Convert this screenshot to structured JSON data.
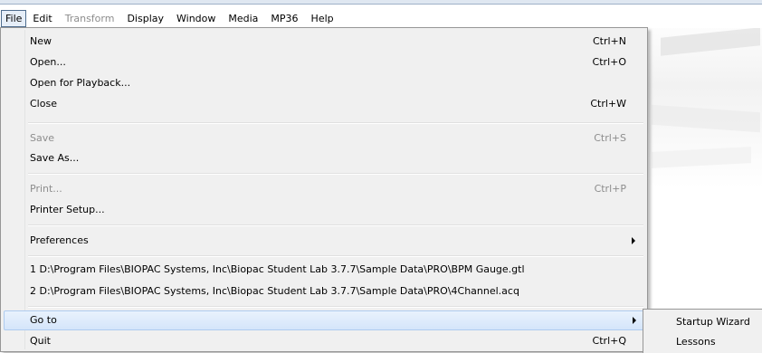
{
  "menubar": {
    "items": [
      {
        "label": "File",
        "state": "active"
      },
      {
        "label": "Edit",
        "state": "normal"
      },
      {
        "label": "Transform",
        "state": "disabled"
      },
      {
        "label": "Display",
        "state": "normal"
      },
      {
        "label": "Window",
        "state": "normal"
      },
      {
        "label": "Media",
        "state": "normal"
      },
      {
        "label": "MP36",
        "state": "normal"
      },
      {
        "label": "Help",
        "state": "normal"
      }
    ]
  },
  "file_menu": {
    "items": [
      {
        "label": "New",
        "shortcut": "Ctrl+N",
        "enabled": true
      },
      {
        "label": "Open...",
        "shortcut": "Ctrl+O",
        "enabled": true
      },
      {
        "label": "Open for Playback...",
        "shortcut": "",
        "enabled": true
      },
      {
        "label": "Close",
        "shortcut": "Ctrl+W",
        "enabled": true
      },
      {
        "label": "Save",
        "shortcut": "Ctrl+S",
        "enabled": false
      },
      {
        "label": "Save As...",
        "shortcut": "",
        "enabled": true
      },
      {
        "label": "Print...",
        "shortcut": "Ctrl+P",
        "enabled": false
      },
      {
        "label": "Printer Setup...",
        "shortcut": "",
        "enabled": true
      },
      {
        "label": "Preferences",
        "shortcut": "",
        "enabled": true,
        "submenu": true
      },
      {
        "label": "1 D:\\Program Files\\BIOPAC Systems, Inc\\Biopac Student Lab 3.7.7\\Sample Data\\PRO\\BPM Gauge.gtl",
        "shortcut": "",
        "enabled": true
      },
      {
        "label": "2 D:\\Program Files\\BIOPAC Systems, Inc\\Biopac Student Lab 3.7.7\\Sample Data\\PRO\\4Channel.acq",
        "shortcut": "",
        "enabled": true
      },
      {
        "label": "Go to",
        "shortcut": "",
        "enabled": true,
        "submenu": true,
        "highlighted": true
      },
      {
        "label": "Quit",
        "shortcut": "Ctrl+Q",
        "enabled": true
      }
    ]
  },
  "goto_submenu": {
    "items": [
      {
        "label": "Startup Wizard"
      },
      {
        "label": "Lessons"
      }
    ]
  },
  "colors": {
    "menu_bg": "#f0f0f0",
    "highlight": "#d4e5fa",
    "disabled_text": "#8d8d8d"
  }
}
